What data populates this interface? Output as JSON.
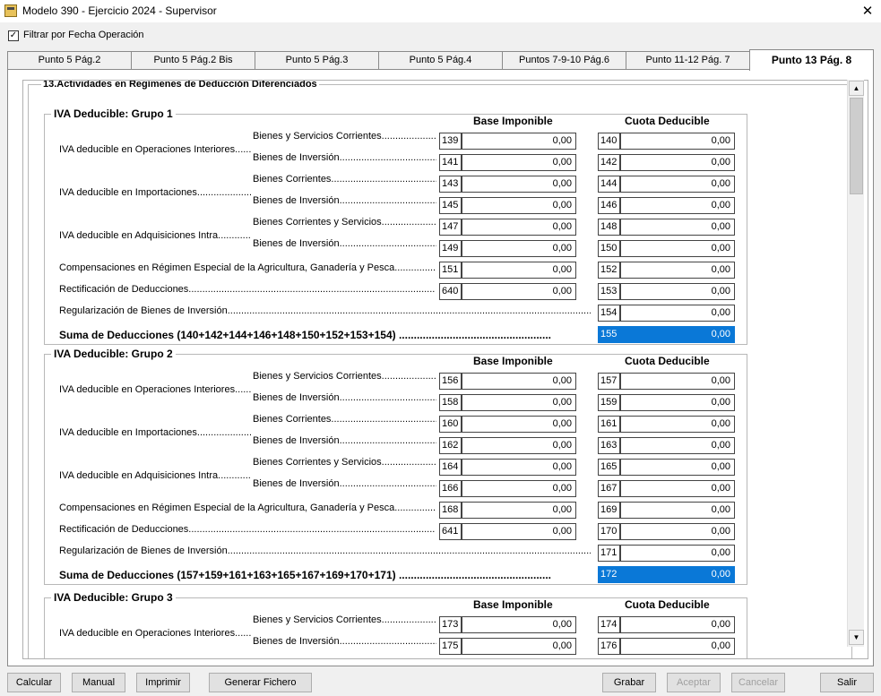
{
  "window": {
    "title": "Modelo 390 -   Ejercicio 2024 - Supervisor",
    "close": "✕"
  },
  "filter": {
    "label": "Filtrar por Fecha Operación",
    "checked": "✓"
  },
  "tabs": [
    {
      "label": "Punto 5 Pág.2"
    },
    {
      "label": "Punto 5 Pág.2 Bis"
    },
    {
      "label": "Punto 5 Pág.3"
    },
    {
      "label": "Punto 5 Pág.4"
    },
    {
      "label": "Puntos 7-9-10 Pág.6"
    },
    {
      "label": "Punto 11-12 Pág. 7"
    },
    {
      "label": "Punto 13 Pág. 8"
    }
  ],
  "section": {
    "title": "13.Actividades en Regímenes de Deducción Diferenciados"
  },
  "columns": {
    "base": "Base Imponible",
    "cuota": "Cuota Deducible"
  },
  "scroll": {
    "up": "▲",
    "down": "▼"
  },
  "groups": [
    {
      "title": "IVA Deducible: Grupo 1",
      "labels": {
        "interiores": "IVA deducible en Operaciones Interiores.........",
        "bsc": "Bienes y Servicios Corrientes.......................",
        "bi1": "Bienes de Inversión..............................................",
        "importaciones": "IVA deducible en Importaciones......................",
        "bc": "Bienes Corrientes..................................................",
        "bi2": "Bienes de Inversión..............................................",
        "intra": "IVA deducible en Adquisiciones Intra.............",
        "bcs": "Bienes Corrientes y Servicios.......................",
        "bi3": "Bienes de Inversión..............................................",
        "compensaciones": "Compensaciones en Régimen Especial de la Agricultura, Ganadería y Pesca.....................",
        "rectificacion": "Rectificación de Deducciones...................................................................................................................................",
        "regularizacion": "Regularización de Bienes de Inversión.........................................................................................................................................................................................................................",
        "suma": "Suma de Deducciones (140+142+144+146+148+150+152+153+154) ..................................................."
      },
      "rows": [
        {
          "bc": "139",
          "bv": "0,00",
          "cc": "140",
          "cv": "0,00"
        },
        {
          "bc": "141",
          "bv": "0,00",
          "cc": "142",
          "cv": "0,00"
        },
        {
          "bc": "143",
          "bv": "0,00",
          "cc": "144",
          "cv": "0,00"
        },
        {
          "bc": "145",
          "bv": "0,00",
          "cc": "146",
          "cv": "0,00"
        },
        {
          "bc": "147",
          "bv": "0,00",
          "cc": "148",
          "cv": "0,00"
        },
        {
          "bc": "149",
          "bv": "0,00",
          "cc": "150",
          "cv": "0,00"
        },
        {
          "bc": "151",
          "bv": "0,00",
          "cc": "152",
          "cv": "0,00"
        },
        {
          "bc": "640",
          "bv": "0,00",
          "cc": "153",
          "cv": "0,00"
        },
        {
          "cc": "154",
          "cv": "0,00"
        },
        {
          "cc": "155",
          "cv": "0,00"
        }
      ]
    },
    {
      "title": "IVA Deducible: Grupo 2",
      "labels": {
        "interiores": "IVA deducible en Operaciones Interiores.........",
        "bsc": "Bienes y Servicios Corrientes.......................",
        "bi1": "Bienes de Inversión..............................................",
        "importaciones": "IVA deducible en Importaciones......................",
        "bc": "Bienes Corrientes..................................................",
        "bi2": "Bienes de Inversión..............................................",
        "intra": "IVA deducible en Adquisiciones Intra.............",
        "bcs": "Bienes Corrientes y Servicios.......................",
        "bi3": "Bienes de Inversión..............................................",
        "compensaciones": "Compensaciones en Régimen Especial de la Agricultura, Ganadería y Pesca.....................",
        "rectificacion": "Rectificación de Deducciones...................................................................................................................................",
        "regularizacion": "Regularización de Bienes de Inversión.........................................................................................................................................................................................................................",
        "suma": "Suma de Deducciones (157+159+161+163+165+167+169+170+171) ..................................................."
      },
      "rows": [
        {
          "bc": "156",
          "bv": "0,00",
          "cc": "157",
          "cv": "0,00"
        },
        {
          "bc": "158",
          "bv": "0,00",
          "cc": "159",
          "cv": "0,00"
        },
        {
          "bc": "160",
          "bv": "0,00",
          "cc": "161",
          "cv": "0,00"
        },
        {
          "bc": "162",
          "bv": "0,00",
          "cc": "163",
          "cv": "0,00"
        },
        {
          "bc": "164",
          "bv": "0,00",
          "cc": "165",
          "cv": "0,00"
        },
        {
          "bc": "166",
          "bv": "0,00",
          "cc": "167",
          "cv": "0,00"
        },
        {
          "bc": "168",
          "bv": "0,00",
          "cc": "169",
          "cv": "0,00"
        },
        {
          "bc": "641",
          "bv": "0,00",
          "cc": "170",
          "cv": "0,00"
        },
        {
          "cc": "171",
          "cv": "0,00"
        },
        {
          "cc": "172",
          "cv": "0,00"
        }
      ]
    },
    {
      "title": "IVA Deducible: Grupo 3",
      "labels": {
        "interiores": "IVA deducible en Operaciones Interiores.........",
        "bsc": "Bienes y Servicios Corrientes.......................",
        "bi1": "Bienes de Inversión.............................................."
      },
      "rows": [
        {
          "bc": "173",
          "bv": "0,00",
          "cc": "174",
          "cv": "0,00"
        },
        {
          "bc": "175",
          "bv": "0,00",
          "cc": "176",
          "cv": "0,00"
        }
      ]
    }
  ],
  "buttons": {
    "calcular": "Calcular",
    "manual": "Manual",
    "imprimir": "Imprimir",
    "generar": "Generar Fichero",
    "grabar": "Grabar",
    "aceptar": "Aceptar",
    "cancelar": "Cancelar",
    "salir": "Salir"
  }
}
